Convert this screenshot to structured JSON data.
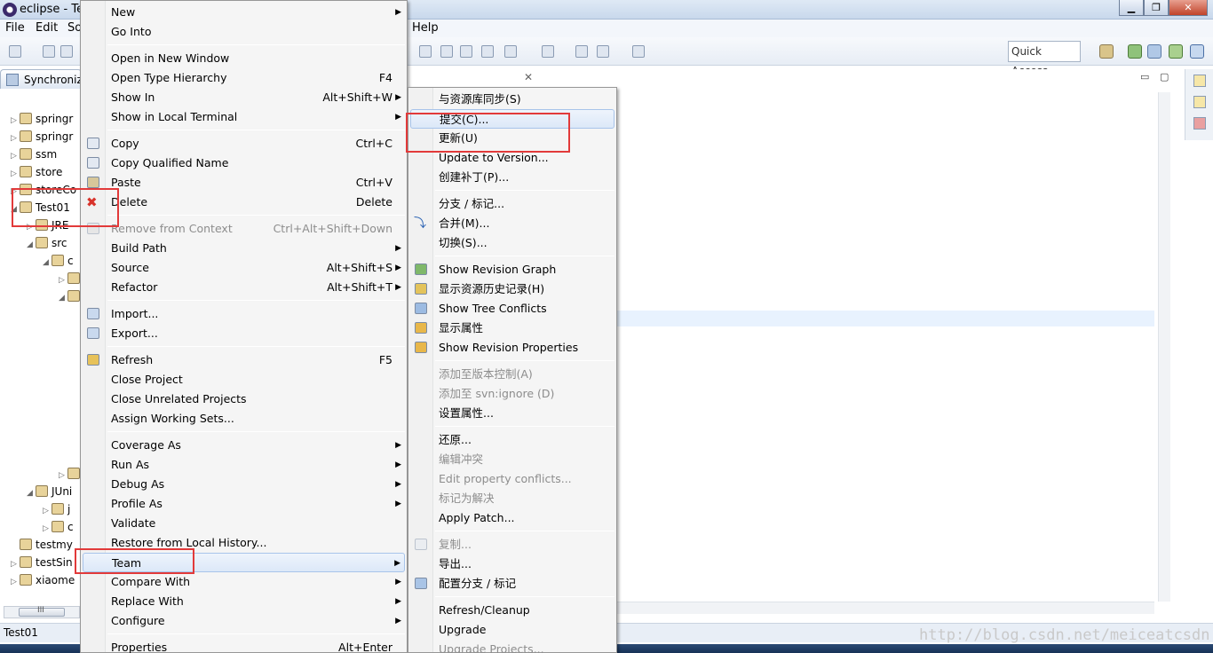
{
  "window": {
    "title": "eclipse - Tes"
  },
  "menubar": {
    "file": "File",
    "edit": "Edit",
    "source_trunc": "So",
    "help": "Help"
  },
  "toolbar": {
    "quick_access": "Quick Access"
  },
  "left_view": {
    "tab_label": "Synchroniz",
    "tree": [
      {
        "label": "springr",
        "indent": 0,
        "twist": "▷"
      },
      {
        "label": "springr",
        "indent": 0,
        "twist": "▷"
      },
      {
        "label": "ssm",
        "indent": 0,
        "twist": "▷"
      },
      {
        "label": "store",
        "indent": 0,
        "twist": "▷"
      },
      {
        "label": "storeCo",
        "indent": 0,
        "twist": "▷"
      },
      {
        "label": "Test01",
        "indent": 0,
        "twist": "◢"
      },
      {
        "label": "JRE",
        "indent": 1,
        "twist": "▷"
      },
      {
        "label": "src",
        "indent": 1,
        "twist": "◢"
      },
      {
        "label": "c",
        "indent": 2,
        "twist": "◢"
      },
      {
        "label": "",
        "indent": 3,
        "twist": "▷"
      },
      {
        "label": "",
        "indent": 3,
        "twist": "◢"
      },
      {
        "label": "",
        "indent": 3,
        "twist": "▷"
      },
      {
        "label": "JUni",
        "indent": 1,
        "twist": "◢"
      },
      {
        "label": "j",
        "indent": 2,
        "twist": "▷"
      },
      {
        "label": "c",
        "indent": 2,
        "twist": "▷"
      },
      {
        "label": "testmy",
        "indent": 0,
        "twist": ""
      },
      {
        "label": "testSin",
        "indent": 0,
        "twist": "▷"
      },
      {
        "label": "xiaome",
        "indent": 0,
        "twist": "▷"
      }
    ],
    "scroll_label": "III"
  },
  "status": {
    "selection": "Test01"
  },
  "watermark": "http://blog.csdn.net/meiceatcsdn",
  "context_menu": {
    "items": [
      {
        "label": "New",
        "acc": "",
        "sub": true
      },
      {
        "label": "Go Into",
        "acc": ""
      },
      {
        "sep": true
      },
      {
        "label": "Open in New Window",
        "acc": ""
      },
      {
        "label": "Open Type Hierarchy",
        "acc": "F4"
      },
      {
        "label": "Show In",
        "acc": "Alt+Shift+W",
        "sub": true
      },
      {
        "label": "Show in Local Terminal",
        "acc": "",
        "sub": true
      },
      {
        "sep": true
      },
      {
        "label": "Copy",
        "acc": "Ctrl+C",
        "icon": "copy-icon"
      },
      {
        "label": "Copy Qualified Name",
        "acc": "",
        "icon": "copy-qualified-icon"
      },
      {
        "label": "Paste",
        "acc": "Ctrl+V",
        "icon": "paste-icon"
      },
      {
        "label": "Delete",
        "acc": "Delete",
        "icon": "delete-icon"
      },
      {
        "sep": true
      },
      {
        "label": "Remove from Context",
        "acc": "Ctrl+Alt+Shift+Down",
        "disabled": true,
        "icon": "remove-context-icon"
      },
      {
        "label": "Build Path",
        "acc": "",
        "sub": true
      },
      {
        "label": "Source",
        "acc": "Alt+Shift+S",
        "sub": true
      },
      {
        "label": "Refactor",
        "acc": "Alt+Shift+T",
        "sub": true
      },
      {
        "sep": true
      },
      {
        "label": "Import...",
        "acc": "",
        "icon": "import-icon"
      },
      {
        "label": "Export...",
        "acc": "",
        "icon": "export-icon"
      },
      {
        "sep": true
      },
      {
        "label": "Refresh",
        "acc": "F5",
        "icon": "refresh-icon"
      },
      {
        "label": "Close Project",
        "acc": ""
      },
      {
        "label": "Close Unrelated Projects",
        "acc": ""
      },
      {
        "label": "Assign Working Sets...",
        "acc": ""
      },
      {
        "sep": true
      },
      {
        "label": "Coverage As",
        "acc": "",
        "sub": true
      },
      {
        "label": "Run As",
        "acc": "",
        "sub": true
      },
      {
        "label": "Debug As",
        "acc": "",
        "sub": true
      },
      {
        "label": "Profile As",
        "acc": "",
        "sub": true
      },
      {
        "label": "Validate",
        "acc": ""
      },
      {
        "label": "Restore from Local History...",
        "acc": ""
      },
      {
        "label": "Team",
        "acc": "",
        "sub": true,
        "hot": true
      },
      {
        "label": "Compare With",
        "acc": "",
        "sub": true
      },
      {
        "label": "Replace With",
        "acc": "",
        "sub": true
      },
      {
        "label": "Configure",
        "acc": "",
        "sub": true
      },
      {
        "sep": true
      },
      {
        "label": "Properties",
        "acc": "Alt+Enter"
      }
    ]
  },
  "team_menu": {
    "items": [
      {
        "label": "与资源库同步(S)"
      },
      {
        "label": "提交(C)...",
        "hot": true
      },
      {
        "label": "更新(U)"
      },
      {
        "label": "Update to Version..."
      },
      {
        "label": "创建补丁(P)..."
      },
      {
        "sep": true
      },
      {
        "label": "分支 / 标记..."
      },
      {
        "label": "合并(M)...",
        "icon": "merge-icon"
      },
      {
        "label": "切换(S)..."
      },
      {
        "sep": true
      },
      {
        "label": "Show Revision Graph",
        "icon": "revision-graph-icon"
      },
      {
        "label": "显示资源历史记录(H)",
        "icon": "history-icon"
      },
      {
        "label": "Show Tree Conflicts",
        "icon": "tree-conflicts-icon"
      },
      {
        "label": "显示属性",
        "icon": "properties-icon"
      },
      {
        "label": "Show Revision Properties",
        "icon": "revision-properties-icon"
      },
      {
        "sep": true
      },
      {
        "label": "添加至版本控制(A)",
        "disabled": true
      },
      {
        "label": "添加至 svn:ignore (D)",
        "disabled": true
      },
      {
        "label": "设置属性..."
      },
      {
        "sep": true
      },
      {
        "label": "还原..."
      },
      {
        "label": "编辑冲突",
        "disabled": true
      },
      {
        "label": "Edit property conflicts...",
        "disabled": true
      },
      {
        "label": "标记为解决",
        "disabled": true
      },
      {
        "label": "Apply Patch..."
      },
      {
        "sep": true
      },
      {
        "label": "复制...",
        "disabled": true,
        "icon": "copy-icon"
      },
      {
        "label": "导出..."
      },
      {
        "label": "配置分支 / 标记",
        "icon": "configure-branch-icon"
      },
      {
        "sep": true
      },
      {
        "label": "Refresh/Cleanup"
      },
      {
        "label": "Upgrade"
      },
      {
        "label": "Upgrade Projects...",
        "disabled": true
      }
    ]
  }
}
